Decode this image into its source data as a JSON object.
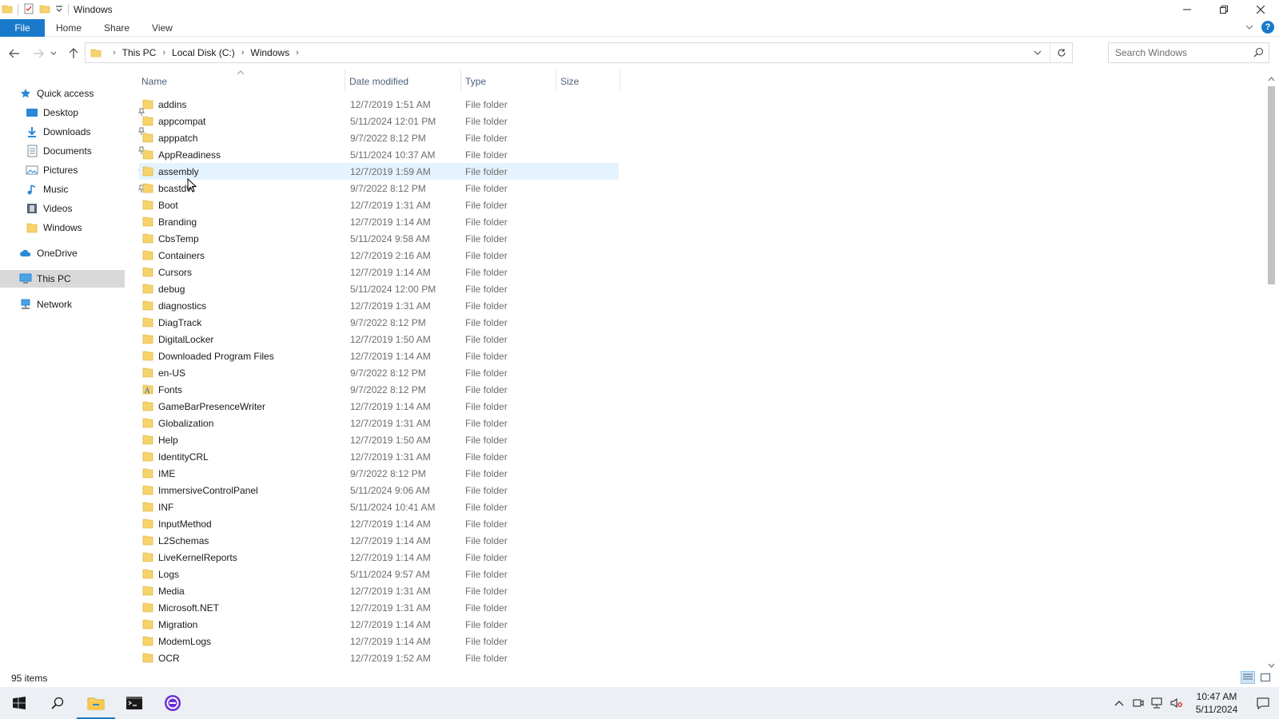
{
  "window": {
    "title": "Windows"
  },
  "ribbon": {
    "tabs": [
      "File",
      "Home",
      "Share",
      "View"
    ]
  },
  "address": {
    "breadcrumbs": [
      "This PC",
      "Local Disk (C:)",
      "Windows"
    ]
  },
  "search": {
    "placeholder": "Search Windows"
  },
  "navpane": {
    "quick_access": "Quick access",
    "items": [
      {
        "label": "Desktop",
        "icon": "desktop-icon",
        "pinned": true
      },
      {
        "label": "Downloads",
        "icon": "downloads-icon",
        "pinned": true
      },
      {
        "label": "Documents",
        "icon": "documents-icon",
        "pinned": true
      },
      {
        "label": "Pictures",
        "icon": "pictures-icon",
        "pinned": true
      },
      {
        "label": "Music",
        "icon": "music-icon",
        "pinned": true
      },
      {
        "label": "Videos",
        "icon": "videos-icon",
        "pinned": false
      },
      {
        "label": "Windows",
        "icon": "folder-icon",
        "pinned": false
      }
    ],
    "onedrive": "OneDrive",
    "this_pc": "This PC",
    "network": "Network"
  },
  "columns": {
    "name": "Name",
    "date": "Date modified",
    "type": "Type",
    "size": "Size"
  },
  "files": [
    {
      "name": "addins",
      "date": "12/7/2019 1:51 AM",
      "type": "File folder"
    },
    {
      "name": "appcompat",
      "date": "5/11/2024 12:01 PM",
      "type": "File folder"
    },
    {
      "name": "apppatch",
      "date": "9/7/2022 8:12 PM",
      "type": "File folder"
    },
    {
      "name": "AppReadiness",
      "date": "5/11/2024 10:37 AM",
      "type": "File folder"
    },
    {
      "name": "assembly",
      "date": "12/7/2019 1:59 AM",
      "type": "File folder"
    },
    {
      "name": "bcastdvr",
      "date": "9/7/2022 8:12 PM",
      "type": "File folder"
    },
    {
      "name": "Boot",
      "date": "12/7/2019 1:31 AM",
      "type": "File folder"
    },
    {
      "name": "Branding",
      "date": "12/7/2019 1:14 AM",
      "type": "File folder"
    },
    {
      "name": "CbsTemp",
      "date": "5/11/2024 9:58 AM",
      "type": "File folder"
    },
    {
      "name": "Containers",
      "date": "12/7/2019 2:16 AM",
      "type": "File folder"
    },
    {
      "name": "Cursors",
      "date": "12/7/2019 1:14 AM",
      "type": "File folder"
    },
    {
      "name": "debug",
      "date": "5/11/2024 12:00 PM",
      "type": "File folder"
    },
    {
      "name": "diagnostics",
      "date": "12/7/2019 1:31 AM",
      "type": "File folder"
    },
    {
      "name": "DiagTrack",
      "date": "9/7/2022 8:12 PM",
      "type": "File folder"
    },
    {
      "name": "DigitalLocker",
      "date": "12/7/2019 1:50 AM",
      "type": "File folder"
    },
    {
      "name": "Downloaded Program Files",
      "date": "12/7/2019 1:14 AM",
      "type": "File folder"
    },
    {
      "name": "en-US",
      "date": "9/7/2022 8:12 PM",
      "type": "File folder"
    },
    {
      "name": "Fonts",
      "date": "9/7/2022 8:12 PM",
      "type": "File folder"
    },
    {
      "name": "GameBarPresenceWriter",
      "date": "12/7/2019 1:14 AM",
      "type": "File folder"
    },
    {
      "name": "Globalization",
      "date": "12/7/2019 1:31 AM",
      "type": "File folder"
    },
    {
      "name": "Help",
      "date": "12/7/2019 1:50 AM",
      "type": "File folder"
    },
    {
      "name": "IdentityCRL",
      "date": "12/7/2019 1:31 AM",
      "type": "File folder"
    },
    {
      "name": "IME",
      "date": "9/7/2022 8:12 PM",
      "type": "File folder"
    },
    {
      "name": "ImmersiveControlPanel",
      "date": "5/11/2024 9:06 AM",
      "type": "File folder"
    },
    {
      "name": "INF",
      "date": "5/11/2024 10:41 AM",
      "type": "File folder"
    },
    {
      "name": "InputMethod",
      "date": "12/7/2019 1:14 AM",
      "type": "File folder"
    },
    {
      "name": "L2Schemas",
      "date": "12/7/2019 1:14 AM",
      "type": "File folder"
    },
    {
      "name": "LiveKernelReports",
      "date": "12/7/2019 1:14 AM",
      "type": "File folder"
    },
    {
      "name": "Logs",
      "date": "5/11/2024 9:57 AM",
      "type": "File folder"
    },
    {
      "name": "Media",
      "date": "12/7/2019 1:31 AM",
      "type": "File folder"
    },
    {
      "name": "Microsoft.NET",
      "date": "12/7/2019 1:31 AM",
      "type": "File folder"
    },
    {
      "name": "Migration",
      "date": "12/7/2019 1:14 AM",
      "type": "File folder"
    },
    {
      "name": "ModemLogs",
      "date": "12/7/2019 1:14 AM",
      "type": "File folder"
    },
    {
      "name": "OCR",
      "date": "12/7/2019 1:52 AM",
      "type": "File folder"
    }
  ],
  "status": {
    "item_count": "95 items"
  },
  "taskbar": {
    "time": "10:47 AM",
    "date": "5/11/2024"
  },
  "colors": {
    "accent": "#1979ca",
    "folder": "#f6d36b",
    "hover_row": "#e5f3ff",
    "selected_nav": "#d9d9d9"
  }
}
